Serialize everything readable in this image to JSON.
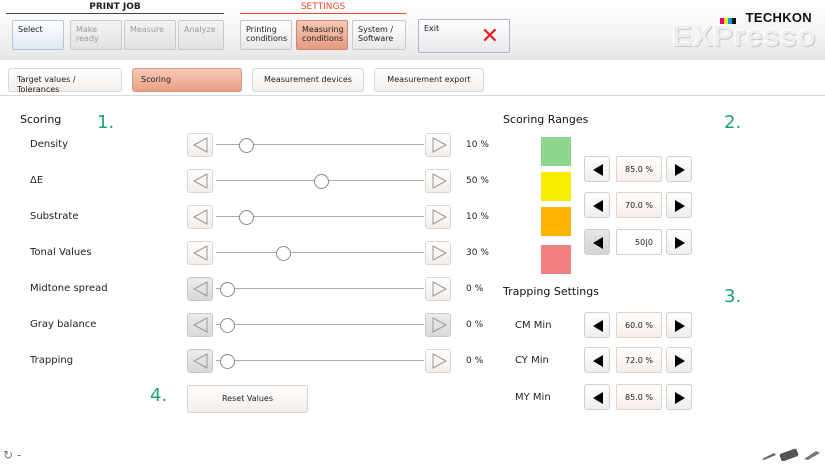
{
  "header": {
    "print_job_label": "PRINT JOB",
    "settings_label": "SETTINGS",
    "print_job_tabs": [
      {
        "label": "Select",
        "state": "selected"
      },
      {
        "label": "Make ready",
        "state": "disabled"
      },
      {
        "label": "Measure",
        "state": "disabled"
      },
      {
        "label": "Analyze",
        "state": "disabled"
      }
    ],
    "settings_tabs": [
      {
        "label": "Printing\nconditions",
        "state": "normal"
      },
      {
        "label": "Measuring\nconditions",
        "state": "active"
      },
      {
        "label": "System /\nSoftware",
        "state": "normal"
      }
    ],
    "exit_label": "Exit",
    "brand": {
      "name": "TECHKON",
      "product": "EXPresso"
    }
  },
  "subtabs": [
    {
      "label": "Target values / Tolerances",
      "active": false
    },
    {
      "label": "Scoring",
      "active": true
    },
    {
      "label": "Measurement devices",
      "active": false
    },
    {
      "label": "Measurement export",
      "active": false
    }
  ],
  "scoring": {
    "title": "Scoring",
    "marker": "1.",
    "rows": [
      {
        "label": "Density",
        "value": "10 %",
        "level": 10,
        "enabled": true
      },
      {
        "label": "ΔE",
        "value": "50 %",
        "level": 50,
        "enabled": true
      },
      {
        "label": "Substrate",
        "value": "10 %",
        "level": 10,
        "enabled": true
      },
      {
        "label": "Tonal Values",
        "value": "30 %",
        "level": 30,
        "enabled": true
      },
      {
        "label": "Midtone spread",
        "value": "0 %",
        "level": 0,
        "enabled": false
      },
      {
        "label": "Gray balance",
        "value": "0 %",
        "level": 0,
        "enabled": false
      },
      {
        "label": "Trapping",
        "value": "0 %",
        "level": 0,
        "enabled": false
      }
    ],
    "reset_label": "Reset Values",
    "reset_marker": "4."
  },
  "ranges": {
    "title": "Scoring Ranges",
    "marker": "2.",
    "swatch_colors": [
      "#8dd68d",
      "#f5ee00",
      "#ffb400",
      "#f08080"
    ],
    "values": [
      "85.0 %",
      "70.0 %",
      "50|0"
    ]
  },
  "trapping": {
    "title": "Trapping Settings",
    "marker": "3.",
    "rows": [
      {
        "label": "CM Min",
        "value": "60.0 %"
      },
      {
        "label": "CY Min",
        "value": "72.0 %"
      },
      {
        "label": "MY Min",
        "value": "85.0 %"
      }
    ]
  },
  "footer": {
    "status": "-"
  }
}
